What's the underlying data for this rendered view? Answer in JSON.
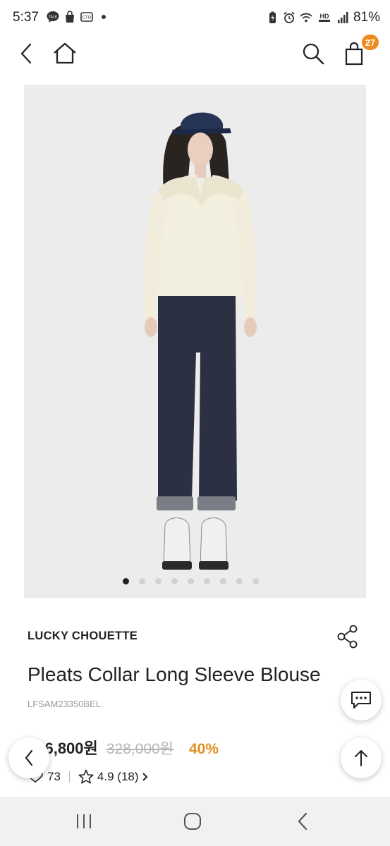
{
  "status_bar": {
    "time": "5:37",
    "battery": "81%",
    "left_icons": [
      "talk-icon",
      "shopping-bag-icon",
      "cto-icon",
      "dot-icon"
    ],
    "right_icons": [
      "battery-saver-icon",
      "alarm-icon",
      "wifi-icon",
      "hd-voice-icon",
      "signal-icon"
    ],
    "hd_label": "HD",
    "cto_label": "CTO",
    "talk_label": "TALK"
  },
  "header": {
    "back_icon": "chevron-left-icon",
    "home_icon": "home-icon",
    "search_icon": "search-icon",
    "cart_icon": "shopping-bag-icon",
    "cart_count": "27"
  },
  "gallery": {
    "image_count": 9,
    "active_index": 0
  },
  "product": {
    "brand": "LUCKY CHOUETTE",
    "name": "Pleats Collar Long Sleeve Blouse",
    "code": "LFSAM23350BEL",
    "sale_price": "196,800원",
    "original_price": "328,000원",
    "discount": "40%",
    "likes": "73",
    "rating": "4.9 (18)"
  },
  "floating": {
    "chat_icon": "chat-bubble-icon",
    "back_icon": "chevron-left-icon",
    "top_icon": "arrow-up-icon"
  },
  "nav": {
    "recents_icon": "recents-icon",
    "home_icon": "home-circle-icon",
    "back_icon": "back-icon"
  },
  "colors": {
    "accent": "#f08a1c",
    "discount": "#e0901c",
    "image_bg": "#ececec"
  }
}
